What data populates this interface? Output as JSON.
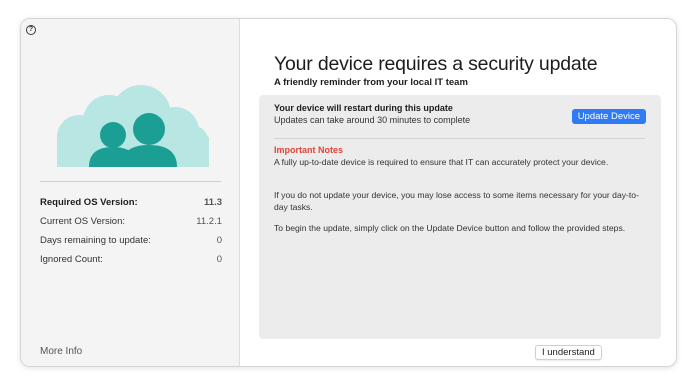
{
  "window": {
    "help_icon_glyph": "?"
  },
  "sidebar": {
    "illustration_icon": "cloud-users-icon",
    "info": [
      {
        "label": "Required OS Version:",
        "value": "11.3"
      },
      {
        "label": "Current OS Version:",
        "value": "11.2.1"
      },
      {
        "label": "Days remaining to update:",
        "value": "0"
      },
      {
        "label": "Ignored Count:",
        "value": "0"
      }
    ],
    "more_info_label": "More Info"
  },
  "main": {
    "title": "Your device requires a security update",
    "subtitle": "A friendly reminder from your local IT team",
    "restart_title": "Your device will restart during this update",
    "restart_subtitle": "Updates can take around 30 minutes to complete",
    "update_button_label": "Update Device",
    "notes_title": "Important Notes",
    "notes": [
      "A fully up-to-date device is required to ensure that IT can accurately protect your device.",
      "If you do not update your device, you may lose access to some items necessary for your day-to-day tasks.",
      "To begin the update, simply click on the Update Device button and follow the provided steps."
    ],
    "understand_button_label": "I understand"
  },
  "colors": {
    "accent_button": "#2f7bf6",
    "important_notes": "#e0453a",
    "cloud": "#b7e6e3",
    "people": "#1b9e93"
  }
}
